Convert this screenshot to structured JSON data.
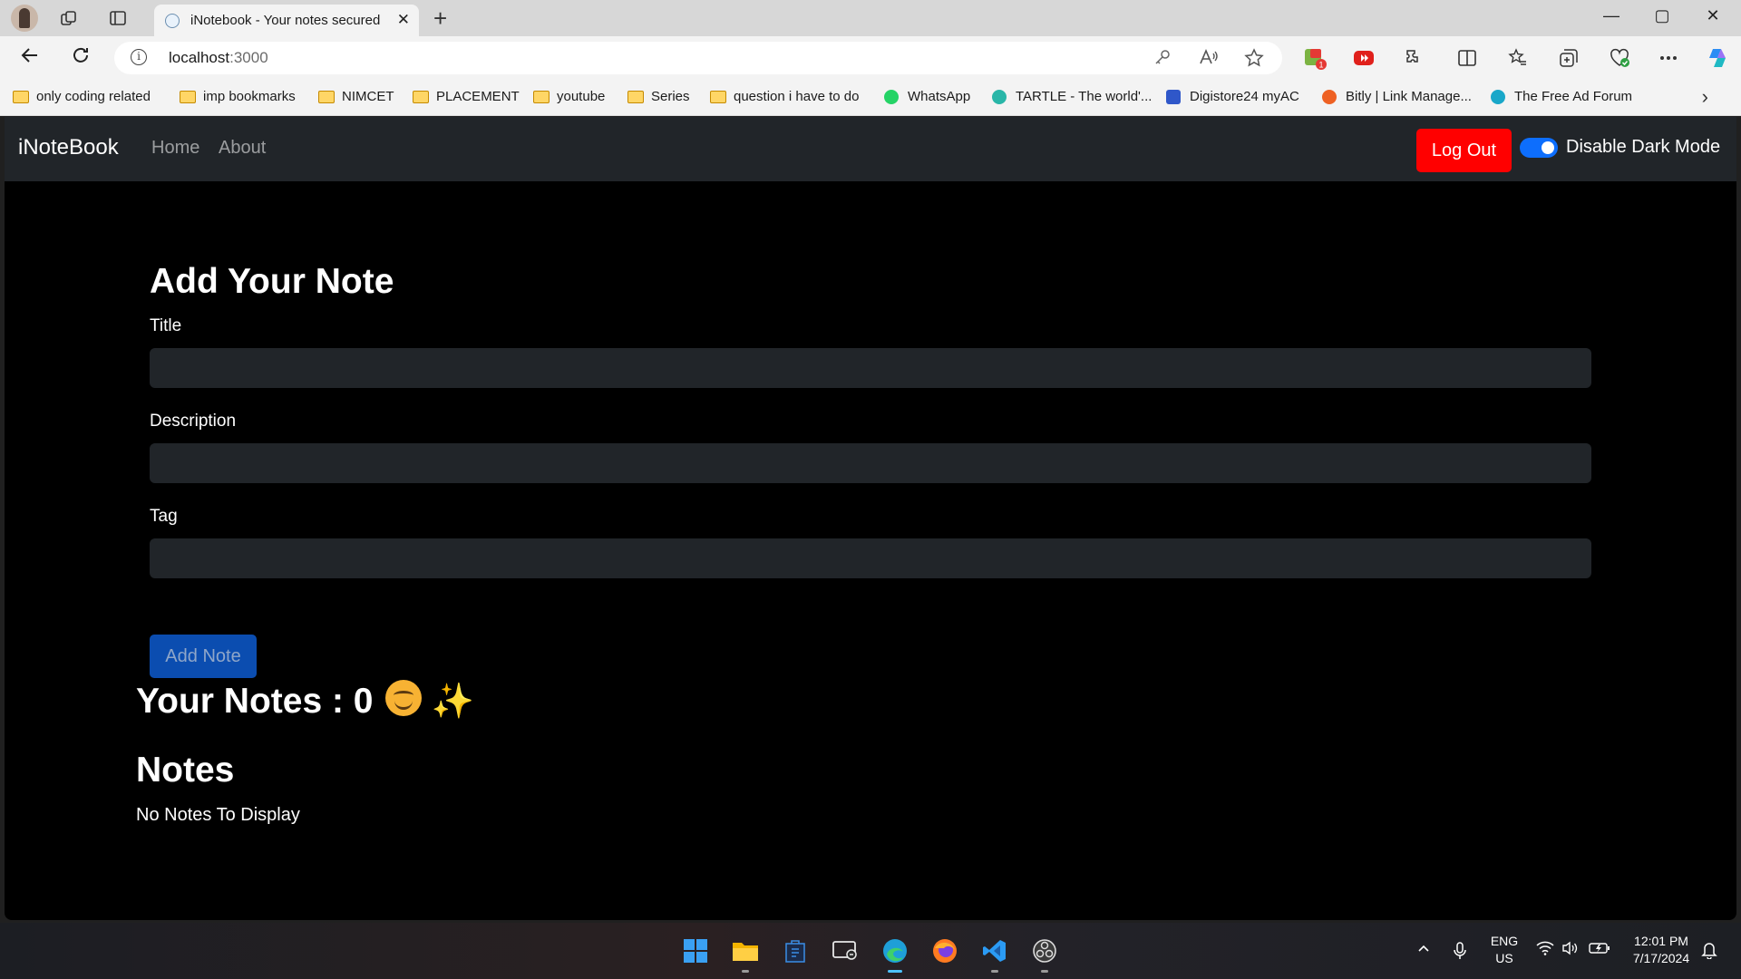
{
  "browser": {
    "tab_title": "iNotebook - Your notes secured on the cloud",
    "tab_close": "✕",
    "new_tab": "+",
    "url_host": "localhost",
    "url_port": ":3000",
    "window_controls": {
      "minimize": "—",
      "maximize": "▢",
      "close": "✕"
    },
    "bookmarks": [
      {
        "label": "only coding  related",
        "kind": "folder"
      },
      {
        "label": "imp bookmarks",
        "kind": "folder"
      },
      {
        "label": "NIMCET",
        "kind": "folder"
      },
      {
        "label": "PLACEMENT",
        "kind": "folder"
      },
      {
        "label": "youtube",
        "kind": "folder"
      },
      {
        "label": "Series",
        "kind": "folder"
      },
      {
        "label": "question i have to do",
        "kind": "folder"
      },
      {
        "label": "WhatsApp",
        "kind": "site",
        "color": "#25d366"
      },
      {
        "label": "TARTLE - The world'...",
        "kind": "site",
        "color": "#29b6a8"
      },
      {
        "label": "Digistore24 myAC",
        "kind": "site",
        "color": "#2f57c9"
      },
      {
        "label": "Bitly | Link Manage...",
        "kind": "site",
        "color": "#ee6123"
      },
      {
        "label": "The Free Ad Forum",
        "kind": "site",
        "color": "#19a7c9"
      }
    ],
    "extension_badge": "1"
  },
  "navbar": {
    "brand": "iNoteBook",
    "links": [
      "Home",
      "About"
    ],
    "logout_label": "Log Out",
    "dark_mode_label": "Disable Dark Mode",
    "dark_mode_on": true
  },
  "form": {
    "heading": "Add Your Note",
    "title_label": "Title",
    "title_value": "",
    "description_label": "Description",
    "description_value": "",
    "tag_label": "Tag",
    "tag_value": "",
    "submit_label": "Add Note"
  },
  "notes": {
    "count_heading": "Your Notes : 0",
    "sparkle": "✨",
    "section_heading": "Notes",
    "empty_text": "No Notes To Display"
  },
  "taskbar": {
    "lang": "ENG",
    "region": "US",
    "time": "12:01 PM",
    "date": "7/17/2024"
  },
  "colors": {
    "logout": "#ff0000",
    "add_note": "#0b4db0",
    "toggle": "#0d6efd",
    "navbar": "#212529"
  }
}
